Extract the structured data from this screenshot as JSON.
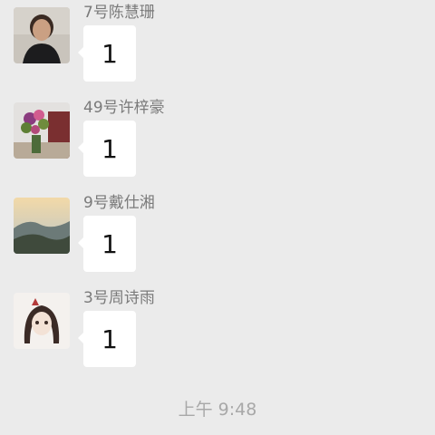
{
  "messages": [
    {
      "sender": "7号陈慧珊",
      "text": "1",
      "avatar": "woman-portrait"
    },
    {
      "sender": "49号许梓豪",
      "text": "1",
      "avatar": "flower-bouquet"
    },
    {
      "sender": "9号戴仕湘",
      "text": "1",
      "avatar": "mountain-landscape"
    },
    {
      "sender": "3号周诗雨",
      "text": "1",
      "avatar": "anime-character"
    }
  ],
  "timestamp": "上午 9:48"
}
